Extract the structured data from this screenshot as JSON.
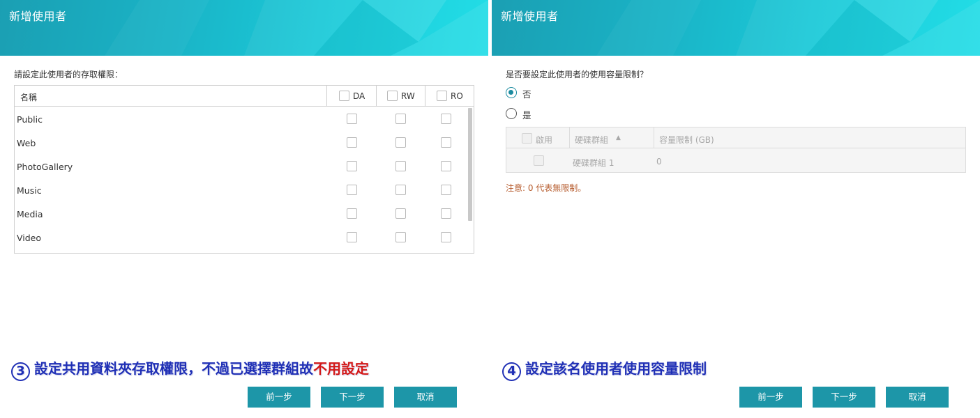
{
  "left_panel": {
    "title": "新增使用者",
    "prompt": "請設定此使用者的存取權限：",
    "table": {
      "name_header": "名稱",
      "columns": [
        "DA",
        "RW",
        "RO"
      ],
      "rows": [
        "Public",
        "Web",
        "PhotoGallery",
        "Music",
        "Media",
        "Video"
      ]
    },
    "caption": {
      "number": "3",
      "text": "設定共用資料夾存取權限，不過已選擇群組故",
      "highlight": "不用設定"
    },
    "buttons": {
      "prev": "前一步",
      "next": "下一步",
      "cancel": "取消"
    }
  },
  "right_panel": {
    "title": "新增使用者",
    "prompt": "是否要設定此使用者的使用容量限制？",
    "options": [
      {
        "label": "否",
        "checked": true
      },
      {
        "label": "是",
        "checked": false
      }
    ],
    "table": {
      "headers": {
        "enable": "啟用",
        "group": "硬碟群組",
        "limit": "容量限制 (GB)"
      },
      "rows": [
        {
          "group": "硬碟群組 1",
          "limit": "0"
        }
      ]
    },
    "note": "注意: 0 代表無限制。",
    "caption": {
      "number": "4",
      "text": "設定該名使用者使用容量限制"
    },
    "buttons": {
      "prev": "前一步",
      "next": "下一步",
      "cancel": "取消"
    }
  },
  "colors": {
    "header_start": "#1b9fb3",
    "header_end": "#22dde6",
    "button": "#1d96a8",
    "caption": "#1f2fb5",
    "highlight": "#d31818",
    "note": "#b5592a"
  }
}
